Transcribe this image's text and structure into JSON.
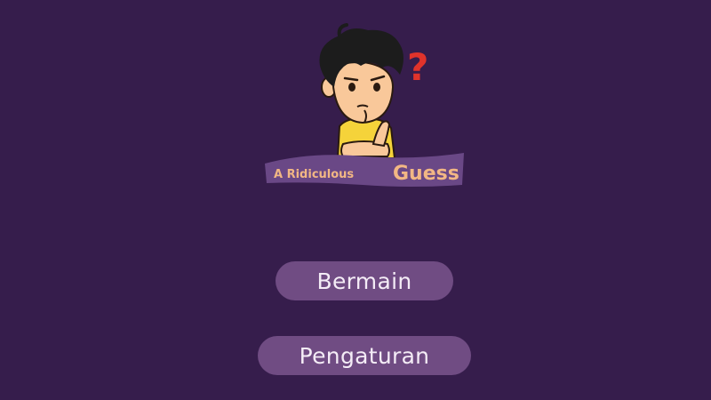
{
  "game": {
    "logo": {
      "title_prefix": "A Ridiculous",
      "title_main": "Guess",
      "question_mark": "?"
    },
    "menu": {
      "play_label": "Bermain",
      "settings_label": "Pengaturan"
    }
  },
  "colors": {
    "background": "#361d4c",
    "button": "#704c83",
    "button_text": "#f4ecf6",
    "banner": "#6a4886",
    "banner_text": "#f2b784",
    "question_mark": "#e0332b",
    "shirt": "#f5d33a",
    "skin": "#f9c89a",
    "hair": "#1c1c1c"
  }
}
